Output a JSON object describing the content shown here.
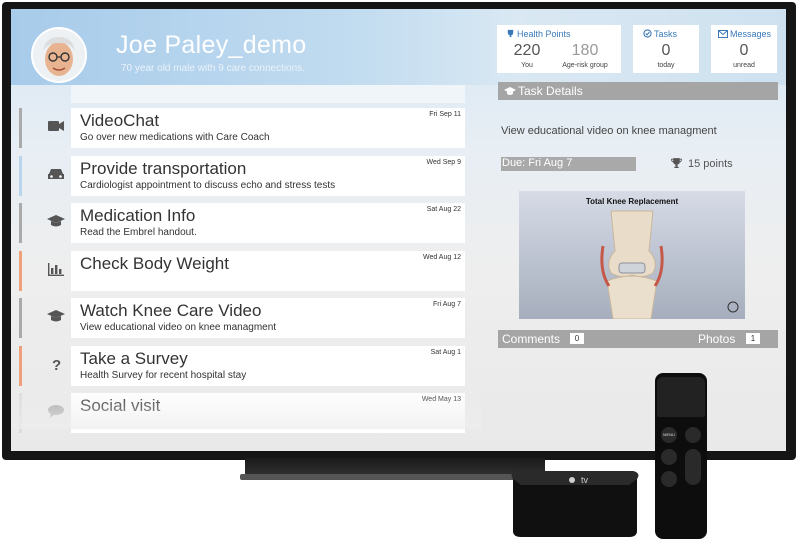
{
  "user": {
    "name": "Joe Paley_demo",
    "subtitle": "70 year old male  with 9 care connections."
  },
  "stats": {
    "health_points": {
      "title": "Health Points",
      "you_value": "220",
      "you_label": "You",
      "group_value": "180",
      "group_label": "Age-risk group"
    },
    "tasks": {
      "title": "Tasks",
      "value": "0",
      "label": "today"
    },
    "messages": {
      "title": "Messages",
      "value": "0",
      "label": "unread"
    }
  },
  "tasks": [
    {
      "title": "VideoChat",
      "desc": "Go over new medications with Care Coach",
      "date": "Fri Sep 11",
      "icon": "video-camera-icon",
      "color": "#aaaaaa"
    },
    {
      "title": "Provide transportation",
      "desc": "Cardiologist appointment to discuss echo and stress tests",
      "date": "Wed Sep 9",
      "icon": "car-icon",
      "color": "#b9d5ee"
    },
    {
      "title": "Medication Info",
      "desc": "Read the Embrel handout.",
      "date": "Sat Aug 22",
      "icon": "graduation-cap-icon",
      "color": "#aaaaaa"
    },
    {
      "title": "Check Body Weight",
      "desc": "",
      "date": "Wed Aug 12",
      "icon": "bar-chart-icon",
      "color": "#f0a07a"
    },
    {
      "title": "Watch Knee Care Video",
      "desc": "View educational video on knee managment",
      "date": "Fri Aug 7",
      "icon": "graduation-cap-icon",
      "color": "#aaaaaa"
    },
    {
      "title": "Take a Survey",
      "desc": "Health Survey for recent hospital stay",
      "date": "Sat Aug 1",
      "icon": "question-icon",
      "color": "#f0a07a"
    },
    {
      "title": "Social visit",
      "desc": "",
      "date": "Wed May 13",
      "icon": "chat-icon",
      "color": "#dddddd"
    }
  ],
  "details": {
    "header": "Task Details",
    "description": "View educational video on knee managment",
    "due": "Due: Fri Aug 7",
    "points": "15  points",
    "video_title": "Total Knee Replacement",
    "comments_label": "Comments",
    "comments_count": "0",
    "photos_label": "Photos",
    "photos_count": "1"
  },
  "devices": {
    "apple_tv_label": "tv",
    "remote_menu_label": "MENU"
  }
}
